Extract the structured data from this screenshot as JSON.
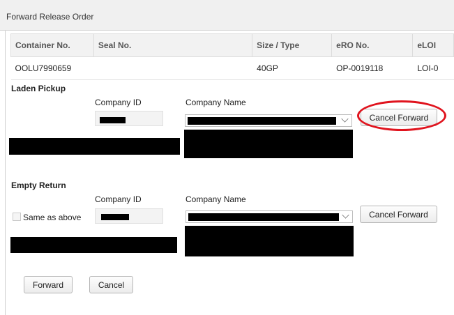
{
  "window": {
    "title": "Forward Release Order"
  },
  "table": {
    "headers": [
      "Container No.",
      "Seal No.",
      "Size / Type",
      "eRO No.",
      "eLOI"
    ],
    "rows": [
      [
        "OOLU7990659",
        "",
        "40GP",
        "OP-0019118",
        "LOI-0"
      ]
    ]
  },
  "laden_pickup": {
    "title": "Laden Pickup",
    "company_id_label": "Company ID",
    "company_name_label": "Company Name",
    "cancel_forward_label": "Cancel Forward"
  },
  "empty_return": {
    "title": "Empty Return",
    "same_as_above_label": "Same as above",
    "company_id_label": "Company ID",
    "company_name_label": "Company Name",
    "cancel_forward_label": "Cancel Forward"
  },
  "footer": {
    "forward_label": "Forward",
    "cancel_label": "Cancel"
  },
  "annotation": {
    "highlight_color": "#e0141e"
  }
}
